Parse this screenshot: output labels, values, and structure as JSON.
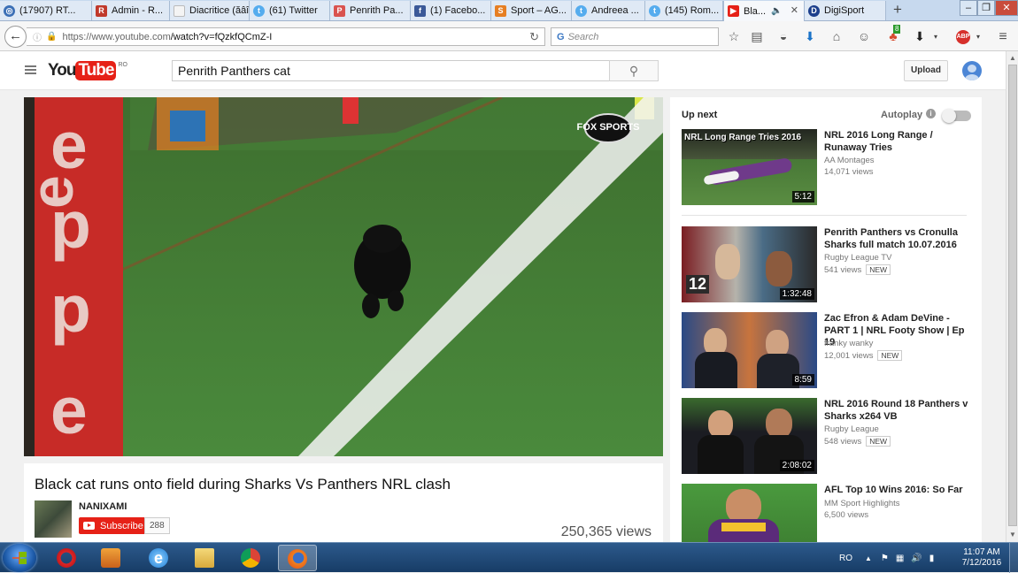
{
  "browser": {
    "tabs": [
      {
        "label": "(17907) RT...",
        "icon": "globe-icon",
        "color": "#3b6fb6"
      },
      {
        "label": "Admin - R...",
        "icon": "admin-icon",
        "color": "#c0392b"
      },
      {
        "label": "Diacritice (ăâîș...",
        "icon": "blank-page-icon",
        "color": "#dfe9f5"
      },
      {
        "label": "(61) Twitter",
        "icon": "twitter-icon",
        "color": "#55acee"
      },
      {
        "label": "Penrith Pa...",
        "icon": "panthers-icon",
        "color": "#d9534f"
      },
      {
        "label": "(1) Facebo...",
        "icon": "facebook-icon",
        "color": "#3b5998"
      },
      {
        "label": "Sport – AG...",
        "icon": "sport-icon",
        "color": "#e67e22"
      },
      {
        "label": "Andreea ...",
        "icon": "twitter-icon",
        "color": "#55acee"
      },
      {
        "label": "(145) Rom...",
        "icon": "twitter-icon",
        "color": "#55acee"
      },
      {
        "label": "Bla...",
        "icon": "youtube-icon",
        "color": "#e62117",
        "active": true
      },
      {
        "label": "DigiSport",
        "icon": "digisport-icon",
        "color": "#1c3f8c"
      }
    ],
    "new_tab": "+",
    "url_host": "https://www.youtube.com",
    "url_path": "/watch?v=fQzkfQCmZ-I",
    "search_placeholder": "Search",
    "adblock_badge": "ABP",
    "ext_badge": "8"
  },
  "youtube": {
    "logo_you": "You",
    "logo_tube": "Tube",
    "logo_country": "RO",
    "search_value": "Penrith Panthers cat",
    "upload_label": "Upload",
    "video": {
      "title": "Black cat runs onto field during Sharks Vs Panthers NRL clash",
      "channel": "NANIXAMI",
      "subscribe_label": "Subscribe",
      "subscriber_count": "288",
      "views": "250,365 views",
      "watermark": "FOX SPORTS"
    },
    "up_next_label": "Up next",
    "autoplay_label": "Autoplay",
    "recommendations": [
      {
        "title": "NRL 2016 Long Range / Runaway Tries",
        "channel": "AA Montages",
        "views": "14,071 views",
        "duration": "5:12",
        "new": "",
        "overlay": "NRL Long Range Tries 2016"
      },
      {
        "title": "Penrith Panthers vs Cronulla Sharks full match 10.07.2016",
        "channel": "Rugby League TV",
        "views": "541 views",
        "duration": "1:32:48",
        "new": "NEW"
      },
      {
        "title": "Zac Efron & Adam DeVine - PART 1 | NRL Footy Show | Ep 19",
        "channel": "franky wanky",
        "views": "12,001 views",
        "duration": "8:59",
        "new": "NEW"
      },
      {
        "title": "NRL 2016 Round 18 Panthers v Sharks x264 VB",
        "channel": "Rugby League",
        "views": "548 views",
        "duration": "2:08:02",
        "new": "NEW"
      },
      {
        "title": "AFL Top 10 Wins 2016: So Far",
        "channel": "MM Sport Highlights",
        "views": "6,500 views",
        "duration": "",
        "new": ""
      }
    ]
  },
  "taskbar": {
    "language": "RO",
    "time": "11:07 AM",
    "date": "7/12/2016",
    "apps": [
      "opera-icon",
      "media-player-icon",
      "internet-explorer-icon",
      "file-explorer-icon",
      "chrome-icon",
      "firefox-icon"
    ]
  }
}
